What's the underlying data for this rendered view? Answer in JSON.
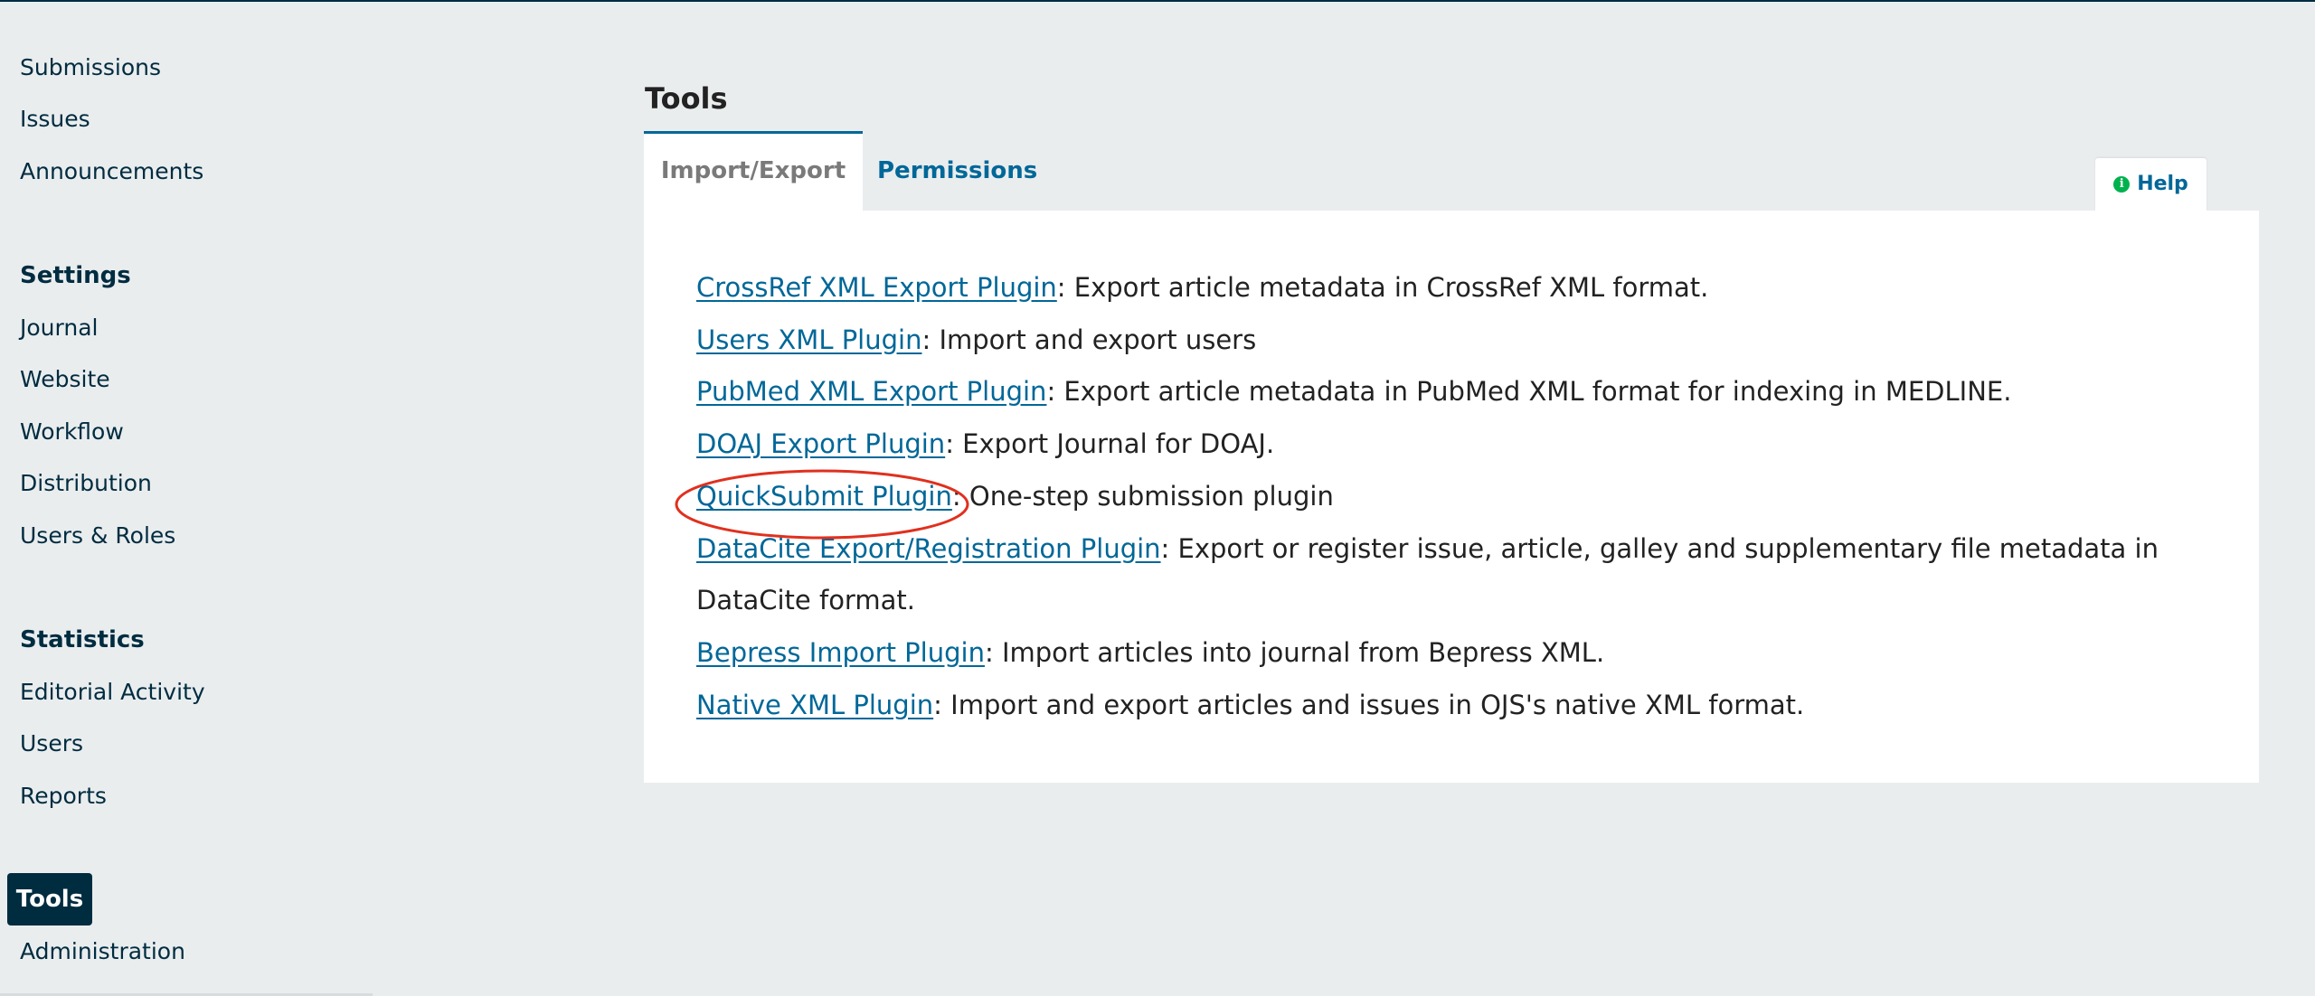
{
  "sidebar": {
    "items_top": [
      "Submissions",
      "Issues",
      "Announcements"
    ],
    "settings_heading": "Settings",
    "settings_items": [
      "Journal",
      "Website",
      "Workflow",
      "Distribution",
      "Users & Roles"
    ],
    "statistics_heading": "Statistics",
    "statistics_items": [
      "Editorial Activity",
      "Users",
      "Reports"
    ],
    "tools_label": "Tools",
    "administration_label": "Administration"
  },
  "page": {
    "title": "Tools"
  },
  "tabs": {
    "import_export": "Import/Export",
    "permissions": "Permissions"
  },
  "help": {
    "label": "Help",
    "icon": "info-circle-icon",
    "icon_color": "#00b24e"
  },
  "plugins": [
    {
      "name": "CrossRef XML Export Plugin",
      "desc": ": Export article metadata in CrossRef XML format."
    },
    {
      "name": "Users XML Plugin",
      "desc": ": Import and export users"
    },
    {
      "name": "PubMed XML Export Plugin",
      "desc": ": Export article metadata in PubMed XML format for indexing in MEDLINE."
    },
    {
      "name": "DOAJ Export Plugin",
      "desc": ": Export Journal for DOAJ."
    },
    {
      "name": "QuickSubmit Plugin",
      "desc": ": One-step submission plugin"
    },
    {
      "name": "DataCite Export/Registration Plugin",
      "desc": ": Export or register issue, article, galley and supplementary file metadata in DataCite format."
    },
    {
      "name": "Bepress Import Plugin",
      "desc": ": Import articles into journal from Bepress XML."
    },
    {
      "name": "Native XML Plugin",
      "desc": ": Import and export articles and issues in OJS's native XML format."
    }
  ],
  "colors": {
    "brand_dark": "#002c40",
    "link": "#006798",
    "annotation": "#e0301e"
  }
}
